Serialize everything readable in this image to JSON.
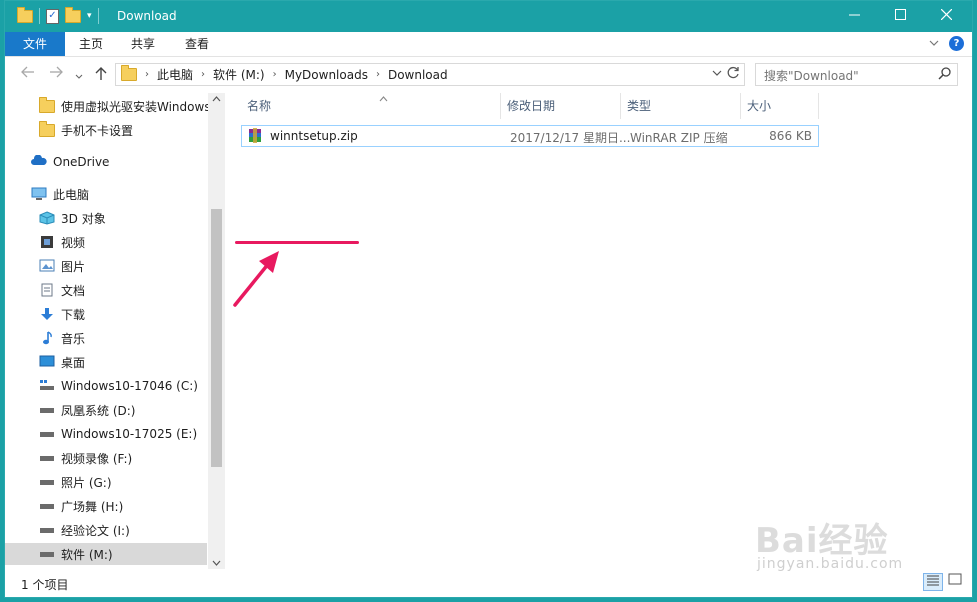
{
  "window": {
    "title": "Download",
    "controls": [
      "minimize",
      "maximize",
      "close"
    ]
  },
  "quick_access_toolbar": {
    "icons": [
      "folder-icon",
      "properties-icon",
      "new-folder-icon"
    ],
    "dropdown": "▾"
  },
  "ribbon": {
    "tabs": [
      {
        "label": "文件",
        "active": true
      },
      {
        "label": "主页"
      },
      {
        "label": "共享"
      },
      {
        "label": "查看"
      }
    ]
  },
  "address": {
    "breadcrumbs": [
      "此电脑",
      "软件 (M:)",
      "MyDownloads",
      "Download"
    ],
    "search_placeholder": "搜索\"Download\""
  },
  "nav_pane": {
    "items": [
      {
        "label": "使用虚拟光驱安装Windows",
        "icon": "folder-icon",
        "indent": 1
      },
      {
        "label": "手机不卡设置",
        "icon": "folder-icon",
        "indent": 1
      },
      {
        "label": "OneDrive",
        "icon": "cloud-icon",
        "indent": 0
      },
      {
        "label": "此电脑",
        "icon": "computer-icon",
        "indent": 0
      },
      {
        "label": "3D 对象",
        "icon": "cube-icon",
        "indent": 1
      },
      {
        "label": "视频",
        "icon": "video-icon",
        "indent": 1
      },
      {
        "label": "图片",
        "icon": "picture-icon",
        "indent": 1
      },
      {
        "label": "文档",
        "icon": "document-icon",
        "indent": 1
      },
      {
        "label": "下载",
        "icon": "download-icon",
        "indent": 1
      },
      {
        "label": "音乐",
        "icon": "music-icon",
        "indent": 1
      },
      {
        "label": "桌面",
        "icon": "desktop-icon",
        "indent": 1
      },
      {
        "label": "Windows10-17046 (C:)",
        "icon": "system-drive-icon",
        "indent": 1
      },
      {
        "label": "凤凰系统 (D:)",
        "icon": "drive-icon",
        "indent": 1
      },
      {
        "label": "Windows10-17025 (E:)",
        "icon": "drive-icon",
        "indent": 1
      },
      {
        "label": "视频录像 (F:)",
        "icon": "drive-icon",
        "indent": 1
      },
      {
        "label": "照片 (G:)",
        "icon": "drive-icon",
        "indent": 1
      },
      {
        "label": "广场舞 (H:)",
        "icon": "drive-icon",
        "indent": 1
      },
      {
        "label": "经验论文 (I:)",
        "icon": "drive-icon",
        "indent": 1
      },
      {
        "label": "软件 (M:)",
        "icon": "drive-icon",
        "indent": 1,
        "selected": true
      }
    ]
  },
  "file_list": {
    "columns": [
      "名称",
      "修改日期",
      "类型",
      "大小"
    ],
    "files": [
      {
        "name": "winntsetup.zip",
        "modified": "2017/12/17 星期日...",
        "type": "WinRAR ZIP 压缩",
        "size": "866 KB"
      }
    ]
  },
  "status": {
    "item_count": "1 个项目"
  },
  "watermark": {
    "brand": "Bai经验",
    "url": "jingyan.baidu.com"
  },
  "colors": {
    "titlebar": "#1ba1a6",
    "file_tab": "#1979ca",
    "annotation": "#e8195f",
    "selection_border": "#99d1ff"
  }
}
